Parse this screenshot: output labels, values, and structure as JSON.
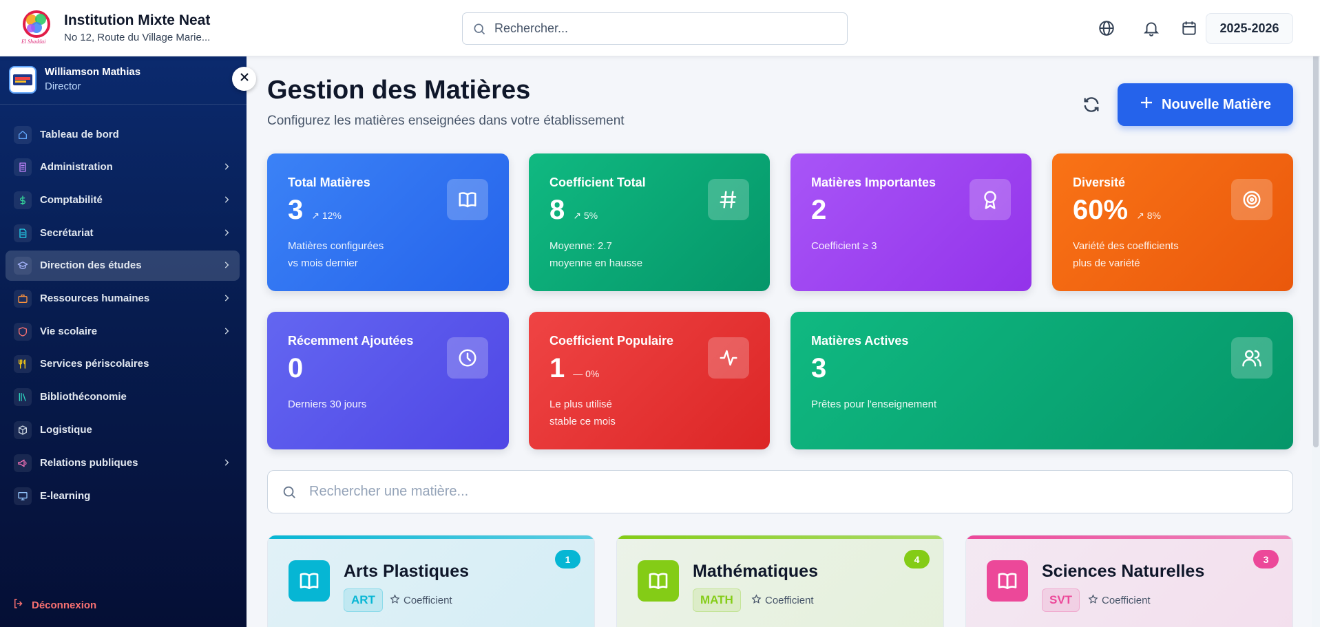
{
  "institution": {
    "name": "Institution Mixte Neat",
    "address": "No 12, Route du Village Marie...",
    "logo_text": "El Shaddai"
  },
  "header": {
    "search_placeholder": "Rechercher...",
    "icons": [
      "globe-icon",
      "bell-icon",
      "calendar-icon"
    ],
    "year": "2025-2026"
  },
  "user": {
    "name": "Williamson Mathias",
    "role": "Director"
  },
  "sidebar": {
    "items": [
      {
        "label": "Tableau de bord",
        "icon": "home-icon",
        "color": "#60a5fa",
        "chevron": false,
        "active": false
      },
      {
        "label": "Administration",
        "icon": "building-icon",
        "color": "#c084fc",
        "chevron": true,
        "active": false
      },
      {
        "label": "Comptabilité",
        "icon": "dollar-icon",
        "color": "#34d399",
        "chevron": true,
        "active": false
      },
      {
        "label": "Secrétariat",
        "icon": "document-icon",
        "color": "#22d3ee",
        "chevron": true,
        "active": false
      },
      {
        "label": "Direction des études",
        "icon": "graduation-cap-icon",
        "color": "#a5b4fc",
        "chevron": true,
        "active": true
      },
      {
        "label": "Ressources humaines",
        "icon": "briefcase-icon",
        "color": "#fb923c",
        "chevron": true,
        "active": false
      },
      {
        "label": "Vie scolaire",
        "icon": "shield-icon",
        "color": "#f87171",
        "chevron": true,
        "active": false
      },
      {
        "label": "Services périscolaires",
        "icon": "utensils-icon",
        "color": "#facc15",
        "chevron": false,
        "active": false
      },
      {
        "label": "Bibliothéconomie",
        "icon": "library-icon",
        "color": "#2dd4bf",
        "chevron": false,
        "active": false
      },
      {
        "label": "Logistique",
        "icon": "package-icon",
        "color": "#cbd5e1",
        "chevron": false,
        "active": false
      },
      {
        "label": "Relations publiques",
        "icon": "megaphone-icon",
        "color": "#f472b6",
        "chevron": true,
        "active": false
      },
      {
        "label": "E-learning",
        "icon": "monitor-icon",
        "color": "#93c5fd",
        "chevron": false,
        "active": false
      }
    ],
    "logout": "Déconnexion"
  },
  "page": {
    "title": "Gestion des Matières",
    "subtitle": "Configurez les matières enseignées dans votre établissement",
    "new_button": "Nouvelle Matière"
  },
  "stats": [
    {
      "title": "Total Matières",
      "value": "3",
      "trend": "12%",
      "line1": "Matières configurées",
      "line2": "vs mois dernier",
      "icon": "book-icon"
    },
    {
      "title": "Coefficient Total",
      "value": "8",
      "trend": "5%",
      "line1": "Moyenne: 2.7",
      "line2": "moyenne en hausse",
      "icon": "hash-icon"
    },
    {
      "title": "Matières Importantes",
      "value": "2",
      "trend": "",
      "line1": "Coefficient ≥ 3",
      "line2": "",
      "icon": "award-icon"
    },
    {
      "title": "Diversité",
      "value": "60%",
      "trend": "8%",
      "line1": "Variété des coefficients",
      "line2": "plus de variété",
      "icon": "target-icon"
    },
    {
      "title": "Récemment Ajoutées",
      "value": "0",
      "trend": "",
      "line1": "Derniers 30 jours",
      "line2": "",
      "icon": "clock-icon"
    },
    {
      "title": "Coefficient Populaire",
      "value": "1",
      "trend": "0%",
      "line1": "Le plus utilisé",
      "line2": "stable ce mois",
      "icon": "activity-icon"
    },
    {
      "title": "Matières Actives",
      "value": "3",
      "trend": "",
      "line1": "Prêtes pour l'enseignement",
      "line2": "",
      "icon": "users-icon"
    }
  ],
  "subject_search_placeholder": "Rechercher une matière...",
  "subjects": [
    {
      "name": "Arts Plastiques",
      "code": "ART",
      "coef_label": "Coefficient",
      "count": "1",
      "color": "#06b6d4"
    },
    {
      "name": "Mathématiques",
      "code": "MATH",
      "coef_label": "Coefficient",
      "count": "4",
      "color": "#84cc16"
    },
    {
      "name": "Sciences Naturelles",
      "code": "SVT",
      "coef_label": "Coefficient",
      "count": "3",
      "color": "#ec4899"
    }
  ]
}
